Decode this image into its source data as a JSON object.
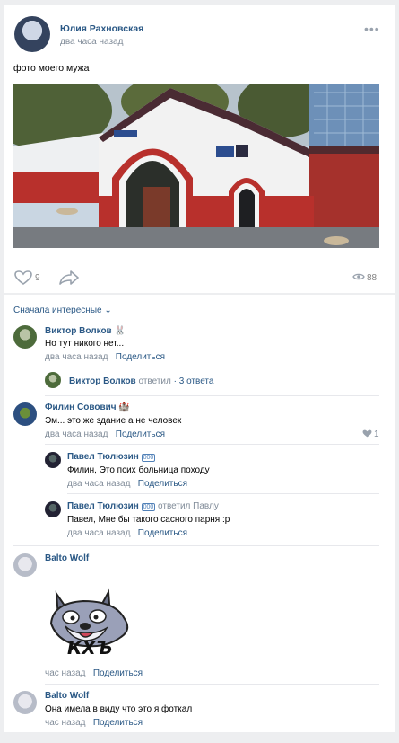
{
  "post": {
    "author": "Юлия Рахновская",
    "time": "два часа назад",
    "text": "фото моего мужа",
    "likes": "9",
    "views": "88",
    "more": "•••"
  },
  "comments": {
    "sort_label": "Сначала интересные",
    "items": [
      {
        "author": "Виктор Волков",
        "emoji": "🐰",
        "text": "Но тут никого нет...",
        "time": "два часа назад",
        "share": "Поделиться"
      },
      {
        "author": "Филин Совович",
        "emoji": "🏰",
        "text": "Эм... это же здание а не человек",
        "time": "два часа назад",
        "share": "Поделиться",
        "likes": "1"
      },
      {
        "author": "Balto Wolf",
        "time": "час назад",
        "share": "Поделиться",
        "sticker_text": "КХЪ"
      },
      {
        "author": "Balto Wolf",
        "text": "Она имела в виду что это я фоткал",
        "time": "час назад",
        "share": "Поделиться"
      }
    ],
    "thread_summary": {
      "author": "Виктор Волков",
      "action": "ответил",
      "count": "· 3 ответа"
    },
    "replies": [
      {
        "author": "Павел Тюлюзин",
        "badge": "000",
        "text": "Филин, Это псих больница походу",
        "time": "два часа назад",
        "share": "Поделиться"
      },
      {
        "author": "Павел Тюлюзин",
        "badge": "000",
        "reply_to": "ответил Павлу",
        "text": "Павел, Мне бы такого сасного парня :p",
        "time": "два часа назад",
        "share": "Поделиться"
      }
    ]
  },
  "colors": {
    "link": "#2a5885",
    "meta": "#818c99",
    "background": "#edeef0"
  }
}
